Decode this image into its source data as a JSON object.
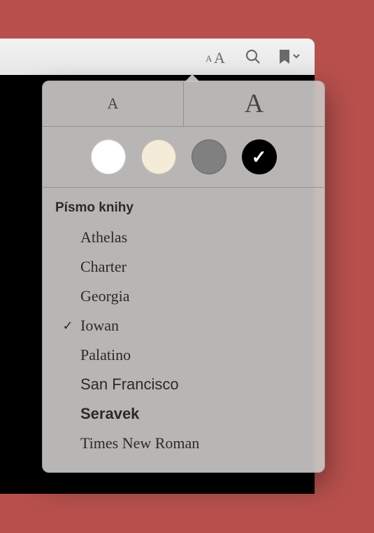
{
  "toolbar": {
    "appearance_icon": "appearance-icon",
    "search_icon": "search-icon",
    "bookmark_icon": "bookmark-icon"
  },
  "popover": {
    "size_small_label": "A",
    "size_large_label": "A",
    "themes": [
      {
        "name": "white",
        "color": "#ffffff",
        "selected": false
      },
      {
        "name": "sepia",
        "color": "#f4ecd8",
        "selected": false
      },
      {
        "name": "gray",
        "color": "#808080",
        "selected": false
      },
      {
        "name": "black",
        "color": "#000000",
        "selected": true
      }
    ],
    "fonts_header": "Písmo knihy",
    "fonts": [
      {
        "label": "Athelas",
        "css": "ff-athelas",
        "selected": false
      },
      {
        "label": "Charter",
        "css": "ff-charter",
        "selected": false
      },
      {
        "label": "Georgia",
        "css": "ff-georgia",
        "selected": false
      },
      {
        "label": "Iowan",
        "css": "ff-iowan",
        "selected": true
      },
      {
        "label": "Palatino",
        "css": "ff-palatino",
        "selected": false
      },
      {
        "label": "San Francisco",
        "css": "ff-sf",
        "selected": false
      },
      {
        "label": "Seravek",
        "css": "ff-seravek",
        "selected": false
      },
      {
        "label": "Times New Roman",
        "css": "ff-tnr",
        "selected": false
      }
    ],
    "checkmark_glyph": "✓"
  }
}
